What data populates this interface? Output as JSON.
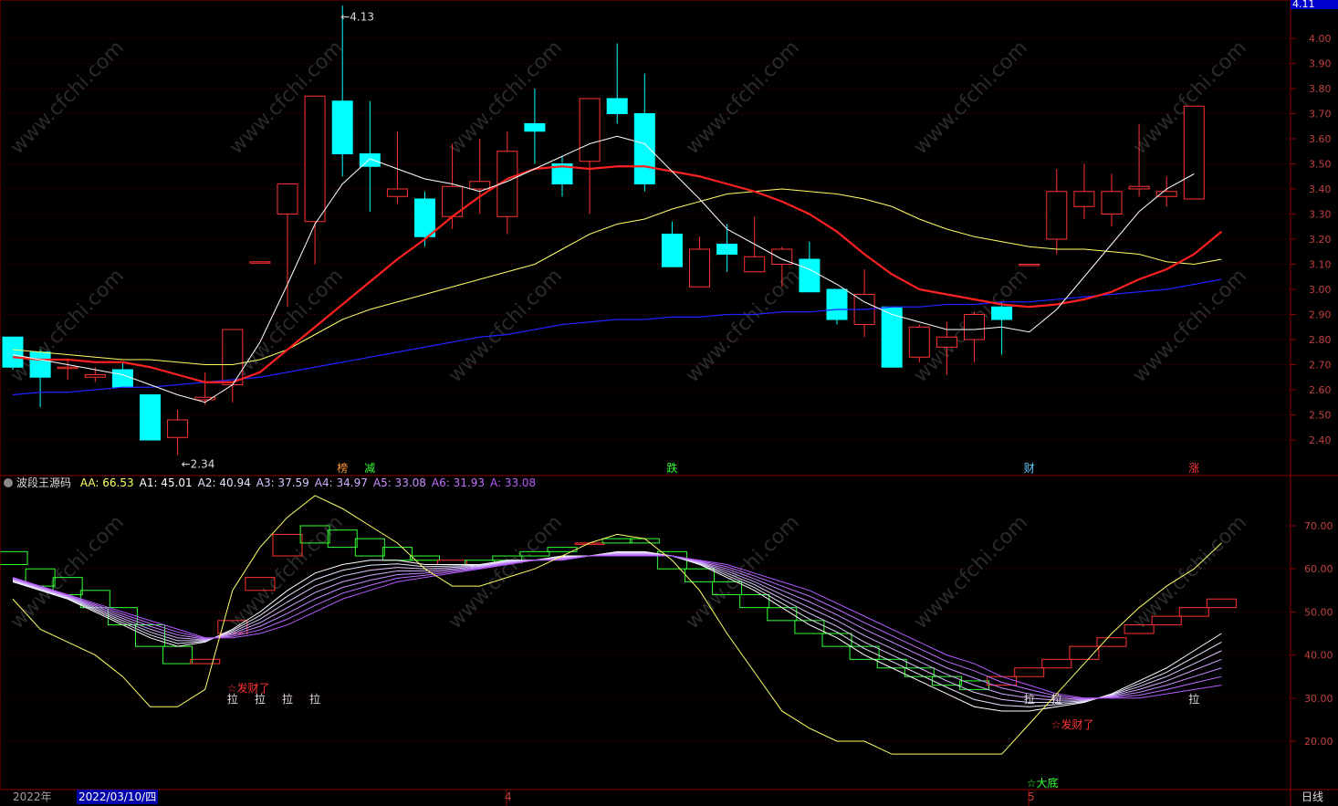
{
  "price_pane": {
    "current_price_badge": "4.11",
    "y_ticks": [
      "4.00",
      "3.90",
      "3.80",
      "3.70",
      "3.60",
      "3.50",
      "3.40",
      "3.30",
      "3.20",
      "3.10",
      "3.00",
      "2.90",
      "2.80",
      "2.70",
      "2.60",
      "2.50",
      "2.40"
    ],
    "high_annotation": "4.13",
    "low_annotation": "2.34",
    "signal_labels": [
      {
        "text": "榜",
        "color": "#ff9933"
      },
      {
        "text": "减",
        "color": "#33ff33"
      },
      {
        "text": "跌",
        "color": "#33ff33"
      },
      {
        "text": "财",
        "color": "#66ccff"
      },
      {
        "text": "涨",
        "color": "#ff3333"
      }
    ],
    "watermark": "www.cfchi.com"
  },
  "indicator_pane": {
    "name": "波段王源码",
    "values": [
      {
        "key": "AA",
        "text": "AA: 66.53",
        "color": "#ffff66"
      },
      {
        "key": "A1",
        "text": "A1: 45.01",
        "color": "#ffffff"
      },
      {
        "key": "A2",
        "text": "A2: 40.94",
        "color": "#e6e6ff"
      },
      {
        "key": "A3",
        "text": "A3: 37.59",
        "color": "#dcc8ff"
      },
      {
        "key": "A4",
        "text": "A4: 34.97",
        "color": "#d2aaff"
      },
      {
        "key": "A5",
        "text": "A5: 33.08",
        "color": "#c88cff"
      },
      {
        "key": "A6",
        "text": "A6: 31.93",
        "color": "#be6eff"
      },
      {
        "key": "A",
        "text": "A: 33.08",
        "color": "#b45aff"
      }
    ],
    "y_ticks": [
      "70.00",
      "60.00",
      "50.00",
      "40.00",
      "30.00",
      "20.00"
    ],
    "annotations": {
      "la": "拉",
      "facai": "☆发财了",
      "dadi": "☆大底"
    }
  },
  "timebar": {
    "year": "2022年",
    "cursor_date": "2022/03/10/四",
    "month_labels": [
      "4",
      "5"
    ],
    "period": "日线"
  },
  "colors": {
    "up": "#ff3333",
    "down": "#00ffff",
    "ma5": "#ffffff",
    "ma10": "#ff2020",
    "ma20": "#ffff66",
    "ma60": "#2222ff",
    "axis": "#8b0000"
  },
  "chart_data": [
    {
      "type": "candlestick",
      "ylim": [
        2.3,
        4.13
      ],
      "y_ticks": [
        4.0,
        3.9,
        3.8,
        3.7,
        3.6,
        3.5,
        3.4,
        3.3,
        3.2,
        3.1,
        3.0,
        2.9,
        2.8,
        2.7,
        2.6,
        2.5,
        2.4
      ],
      "candles": [
        {
          "o": 2.81,
          "h": 2.81,
          "l": 2.68,
          "c": 2.69
        },
        {
          "o": 2.75,
          "h": 2.76,
          "l": 2.53,
          "c": 2.65
        },
        {
          "o": 2.69,
          "h": 2.72,
          "l": 2.64,
          "c": 2.69
        },
        {
          "o": 2.65,
          "h": 2.69,
          "l": 2.63,
          "c": 2.66
        },
        {
          "o": 2.68,
          "h": 2.71,
          "l": 2.61,
          "c": 2.61
        },
        {
          "o": 2.58,
          "h": 2.58,
          "l": 2.4,
          "c": 2.4
        },
        {
          "o": 2.41,
          "h": 2.52,
          "l": 2.34,
          "c": 2.48
        },
        {
          "o": 2.56,
          "h": 2.67,
          "l": 2.54,
          "c": 2.57
        },
        {
          "o": 2.62,
          "h": 2.84,
          "l": 2.55,
          "c": 2.84
        },
        {
          "o": 3.11,
          "h": 3.11,
          "l": 3.11,
          "c": 3.11
        },
        {
          "o": 3.3,
          "h": 3.42,
          "l": 2.93,
          "c": 3.42
        },
        {
          "o": 3.27,
          "h": 3.77,
          "l": 3.1,
          "c": 3.77
        },
        {
          "o": 3.75,
          "h": 4.13,
          "l": 3.45,
          "c": 3.54
        },
        {
          "o": 3.54,
          "h": 3.75,
          "l": 3.31,
          "c": 3.49
        },
        {
          "o": 3.37,
          "h": 3.63,
          "l": 3.34,
          "c": 3.4
        },
        {
          "o": 3.36,
          "h": 3.39,
          "l": 3.17,
          "c": 3.21
        },
        {
          "o": 3.29,
          "h": 3.58,
          "l": 3.24,
          "c": 3.41
        },
        {
          "o": 3.4,
          "h": 3.6,
          "l": 3.3,
          "c": 3.43
        },
        {
          "o": 3.29,
          "h": 3.63,
          "l": 3.22,
          "c": 3.55
        },
        {
          "o": 3.66,
          "h": 3.8,
          "l": 3.5,
          "c": 3.63
        },
        {
          "o": 3.5,
          "h": 3.53,
          "l": 3.37,
          "c": 3.42
        },
        {
          "o": 3.51,
          "h": 3.76,
          "l": 3.3,
          "c": 3.76
        },
        {
          "o": 3.76,
          "h": 3.98,
          "l": 3.66,
          "c": 3.7
        },
        {
          "o": 3.7,
          "h": 3.86,
          "l": 3.39,
          "c": 3.42
        },
        {
          "o": 3.22,
          "h": 3.27,
          "l": 3.09,
          "c": 3.09
        },
        {
          "o": 3.01,
          "h": 3.21,
          "l": 3.01,
          "c": 3.16
        },
        {
          "o": 3.18,
          "h": 3.26,
          "l": 3.07,
          "c": 3.14
        },
        {
          "o": 3.07,
          "h": 3.29,
          "l": 3.07,
          "c": 3.13
        },
        {
          "o": 3.1,
          "h": 3.17,
          "l": 3.01,
          "c": 3.16
        },
        {
          "o": 3.12,
          "h": 3.19,
          "l": 2.99,
          "c": 2.99
        },
        {
          "o": 3.0,
          "h": 3.0,
          "l": 2.86,
          "c": 2.88
        },
        {
          "o": 2.86,
          "h": 3.08,
          "l": 2.81,
          "c": 2.98
        },
        {
          "o": 2.93,
          "h": 2.93,
          "l": 2.69,
          "c": 2.69
        },
        {
          "o": 2.73,
          "h": 2.86,
          "l": 2.71,
          "c": 2.85
        },
        {
          "o": 2.77,
          "h": 2.87,
          "l": 2.66,
          "c": 2.81
        },
        {
          "o": 2.8,
          "h": 2.91,
          "l": 2.71,
          "c": 2.9
        },
        {
          "o": 2.93,
          "h": 2.95,
          "l": 2.74,
          "c": 2.88
        },
        {
          "o": 3.1,
          "h": 3.1,
          "l": 3.1,
          "c": 3.1
        },
        {
          "o": 3.2,
          "h": 3.48,
          "l": 3.14,
          "c": 3.39
        },
        {
          "o": 3.33,
          "h": 3.5,
          "l": 3.28,
          "c": 3.39
        },
        {
          "o": 3.3,
          "h": 3.46,
          "l": 3.25,
          "c": 3.39
        },
        {
          "o": 3.4,
          "h": 3.66,
          "l": 3.37,
          "c": 3.41
        },
        {
          "o": 3.37,
          "h": 3.45,
          "l": 3.33,
          "c": 3.39
        },
        {
          "o": 3.36,
          "h": 3.73,
          "l": 3.36,
          "c": 3.73
        }
      ],
      "ma5": [
        2.74,
        2.72,
        2.7,
        2.68,
        2.66,
        2.62,
        2.58,
        2.55,
        2.62,
        2.79,
        3.02,
        3.26,
        3.42,
        3.52,
        3.48,
        3.44,
        3.42,
        3.39,
        3.43,
        3.48,
        3.53,
        3.58,
        3.61,
        3.58,
        3.47,
        3.36,
        3.24,
        3.18,
        3.12,
        3.08,
        3.02,
        2.95,
        2.9,
        2.87,
        2.84,
        2.84,
        2.85,
        2.83,
        2.92,
        3.05,
        3.18,
        3.31,
        3.4,
        3.46
      ],
      "ma10": [
        2.73,
        2.72,
        2.72,
        2.71,
        2.71,
        2.69,
        2.66,
        2.63,
        2.63,
        2.67,
        2.76,
        2.85,
        2.94,
        3.03,
        3.12,
        3.2,
        3.29,
        3.37,
        3.44,
        3.48,
        3.49,
        3.48,
        3.49,
        3.49,
        3.47,
        3.45,
        3.42,
        3.39,
        3.35,
        3.3,
        3.23,
        3.14,
        3.06,
        3.0,
        2.98,
        2.96,
        2.94,
        2.93,
        2.94,
        2.96,
        2.99,
        3.04,
        3.08,
        3.14,
        3.23
      ],
      "ma20": [
        2.76,
        2.75,
        2.74,
        2.73,
        2.72,
        2.72,
        2.71,
        2.7,
        2.7,
        2.72,
        2.76,
        2.82,
        2.88,
        2.92,
        2.95,
        2.98,
        3.01,
        3.04,
        3.07,
        3.1,
        3.16,
        3.22,
        3.26,
        3.28,
        3.32,
        3.35,
        3.38,
        3.39,
        3.4,
        3.39,
        3.38,
        3.36,
        3.33,
        3.28,
        3.24,
        3.21,
        3.19,
        3.17,
        3.16,
        3.16,
        3.15,
        3.14,
        3.11,
        3.1,
        3.12
      ],
      "ma60": [
        2.58,
        2.59,
        2.59,
        2.6,
        2.61,
        2.61,
        2.62,
        2.63,
        2.64,
        2.65,
        2.67,
        2.69,
        2.71,
        2.73,
        2.75,
        2.77,
        2.79,
        2.81,
        2.82,
        2.84,
        2.86,
        2.87,
        2.88,
        2.88,
        2.89,
        2.89,
        2.9,
        2.9,
        2.91,
        2.91,
        2.92,
        2.92,
        2.93,
        2.93,
        2.94,
        2.94,
        2.95,
        2.95,
        2.96,
        2.97,
        2.98,
        2.99,
        3.0,
        3.02,
        3.04
      ]
    },
    {
      "type": "line",
      "ylim": [
        13,
        80
      ],
      "y_ticks": [
        70,
        60,
        50,
        40,
        30,
        20
      ],
      "series": [
        {
          "name": "AA",
          "values": [
            53,
            46,
            43,
            40,
            35,
            28,
            28,
            32,
            55,
            65,
            72,
            77,
            74,
            70,
            66,
            60,
            56,
            56,
            58,
            60,
            63,
            66,
            68,
            67,
            62,
            55,
            45,
            36,
            27,
            23,
            20,
            20,
            17,
            17,
            17,
            17,
            17,
            24,
            31,
            38,
            45,
            51,
            56,
            60,
            66
          ]
        },
        {
          "name": "A1",
          "values": [
            57,
            55,
            53,
            50,
            47,
            44,
            42,
            43,
            46,
            50,
            55,
            59,
            61,
            62,
            62,
            61,
            61,
            61,
            62,
            62,
            63,
            63,
            64,
            64,
            63,
            61,
            58,
            55,
            51,
            47,
            44,
            40,
            37,
            34,
            31,
            28,
            27,
            27,
            28,
            29,
            31,
            34,
            37,
            41,
            45
          ]
        },
        {
          "name": "A",
          "values": [
            58,
            56,
            54,
            52,
            50,
            48,
            46,
            44,
            44,
            45,
            47,
            50,
            53,
            55,
            57,
            58,
            59,
            60,
            61,
            62,
            62,
            63,
            63,
            63,
            63,
            62,
            61,
            59,
            57,
            55,
            52,
            49,
            46,
            43,
            40,
            38,
            35,
            33,
            31,
            30,
            30,
            30,
            31,
            32,
            33
          ]
        }
      ],
      "box_values": [
        [
          64,
          61
        ],
        [
          60,
          56
        ],
        [
          58,
          54
        ],
        [
          55,
          51
        ],
        [
          51,
          47
        ],
        [
          47,
          42
        ],
        [
          42,
          38
        ],
        [
          38,
          39
        ],
        [
          45,
          48
        ],
        [
          55,
          58
        ],
        [
          63,
          68
        ],
        [
          70,
          66
        ],
        [
          69,
          65
        ],
        [
          67,
          63
        ],
        [
          65,
          62
        ],
        [
          63,
          62
        ],
        [
          61,
          62
        ],
        [
          62,
          61
        ],
        [
          63,
          62
        ],
        [
          64,
          63
        ],
        [
          65,
          64
        ],
        [
          66,
          66
        ],
        [
          67,
          66
        ],
        [
          67,
          66
        ],
        [
          64,
          60
        ],
        [
          60,
          57
        ],
        [
          57,
          54
        ],
        [
          54,
          51
        ],
        [
          51,
          48
        ],
        [
          48,
          45
        ],
        [
          45,
          42
        ],
        [
          42,
          39
        ],
        [
          39,
          37
        ],
        [
          37,
          35
        ],
        [
          35,
          33
        ],
        [
          34,
          32
        ],
        [
          33,
          35
        ],
        [
          35,
          37
        ],
        [
          37,
          39
        ],
        [
          39,
          42
        ],
        [
          42,
          44
        ],
        [
          45,
          47
        ],
        [
          47,
          49
        ],
        [
          49,
          51
        ],
        [
          51,
          53
        ]
      ],
      "annotations": [
        "拉",
        "拉",
        "拉",
        "拉",
        "拉",
        "拉",
        "拉",
        "☆发财了",
        "☆发财了",
        "☆大底"
      ]
    }
  ]
}
